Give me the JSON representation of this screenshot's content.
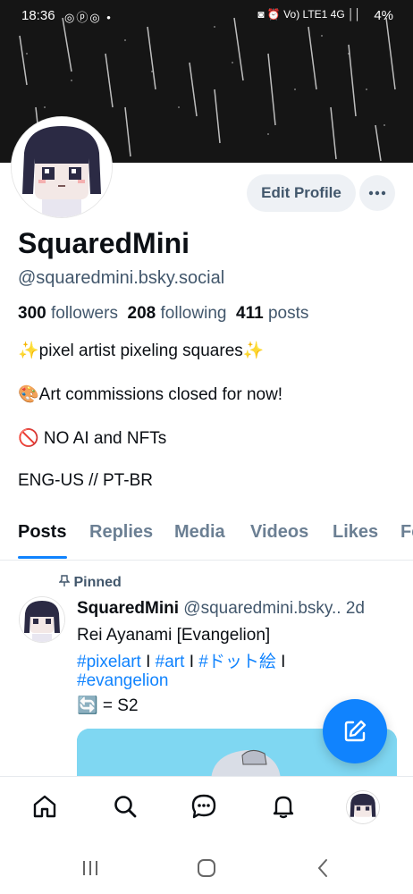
{
  "status_bar": {
    "time": "18:36",
    "notif_icons": "◎ⓟ◎ •",
    "right_icons": "◙ ⏰ Vo) LTE1 4G ││",
    "battery": "4%"
  },
  "profile": {
    "display_name": "SquaredMini",
    "handle": "@squaredmini.bsky.social",
    "followers_count": "300",
    "followers_label": "followers",
    "following_count": "208",
    "following_label": "following",
    "posts_count": "411",
    "posts_label": "posts",
    "edit_button": "Edit Profile",
    "more_button": "···",
    "bio": [
      "✨pixel artist pixeling squares✨",
      "🎨Art commissions closed for now!",
      "🚫 NO AI and NFTs",
      " ENG-US // PT-BR"
    ]
  },
  "tabs": [
    "Posts",
    "Replies",
    "Media",
    "Videos",
    "Likes",
    "Fe"
  ],
  "post": {
    "pinned_label": "Pinned",
    "author": "SquaredMini",
    "handle": "@squaredmini.bsky..",
    "time": "2d",
    "line1": "Rei Ayanami [Evangelion]",
    "tag_pixelart": "#pixelart",
    "sep1": " I ",
    "tag_art": "#art",
    "sep2": " I ",
    "tag_dot": "#ドット絵",
    "sep3": " I",
    "tag_evangelion": "#evangelion",
    "line4": "🔄 = S2"
  },
  "bottom_nav": [
    "home-icon",
    "search-icon",
    "chat-icon",
    "bell-icon",
    "profile-avatar"
  ],
  "colors": {
    "accent": "#1083fe",
    "muted": "#42576c",
    "button_bg": "#eef1f5"
  }
}
